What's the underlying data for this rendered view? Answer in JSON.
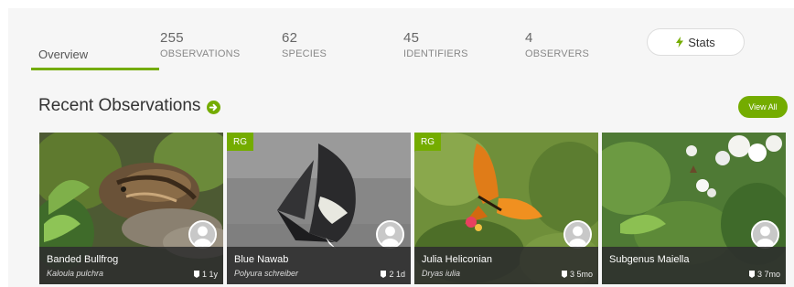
{
  "tabs": {
    "overview": "Overview"
  },
  "stats": [
    {
      "value": "255",
      "label": "OBSERVATIONS"
    },
    {
      "value": "62",
      "label": "SPECIES"
    },
    {
      "value": "45",
      "label": "IDENTIFIERS"
    },
    {
      "value": "4",
      "label": "OBSERVERS"
    }
  ],
  "stats_button": {
    "label": "Stats",
    "icon": "lightning-bolt-icon"
  },
  "recent": {
    "heading": "Recent Observations",
    "heading_icon": "arrow-right-circle-icon",
    "view_all": "View All"
  },
  "observations": [
    {
      "common_name": "Banded Bullfrog",
      "scientific_name": "Kaloula pulchra",
      "ids": "1",
      "age": "1y",
      "badge": ""
    },
    {
      "common_name": "Blue Nawab",
      "scientific_name": "Polyura schreiber",
      "ids": "2",
      "age": "1d",
      "badge": "RG"
    },
    {
      "common_name": "Julia Heliconian",
      "scientific_name": "Dryas iulia",
      "ids": "3",
      "age": "5mo",
      "badge": "RG"
    },
    {
      "common_name": "Subgenus Maiella",
      "scientific_name": "",
      "ids": "3",
      "age": "7mo",
      "badge": ""
    }
  ],
  "colors": {
    "accent": "#74ac00",
    "caption_bg": "#2d2d2d",
    "panel_bg": "#f6f6f6"
  }
}
